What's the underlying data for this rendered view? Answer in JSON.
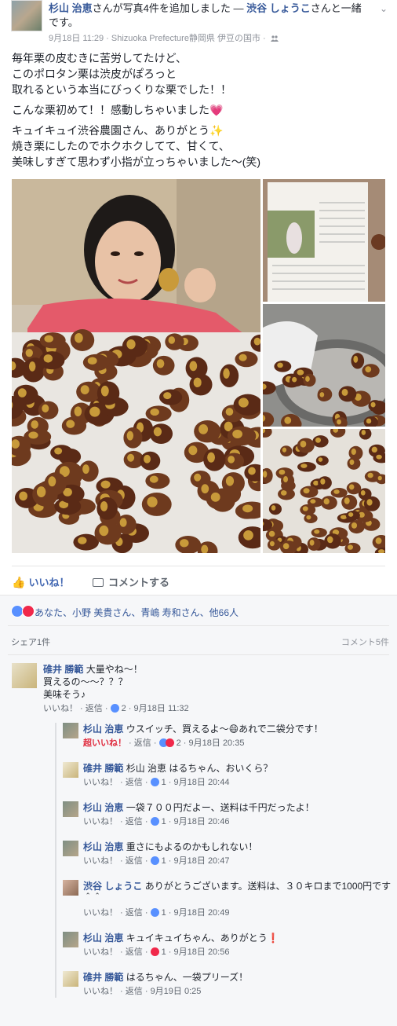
{
  "post": {
    "author": "杉山 治恵",
    "action_text": "さんが写真4件を追加しました — ",
    "tagged": "渋谷 しょうこ",
    "tagged_suffix": "さんと一緒です。",
    "timestamp": "9月18日 11:29 · Shizuoka Prefecture静岡県 伊豆の国市 ·",
    "paragraphs": [
      "毎年栗の皮むきに苦労してたけど、\nこのポロタン栗は渋皮がぽろっと\n取れるという本当にびっくりな栗でした！！",
      "こんな栗初めて！！感動しちゃいました💗",
      "キュイキュイ渋谷農園さん、ありがとう✨\n焼き栗にしたのでホクホクしてて、甘くて、\n美味しすぎて思わず小指が立っちゃいました〜(笑)"
    ]
  },
  "actions": {
    "like": "いいね！",
    "comment": "コメントする"
  },
  "reactions": {
    "text": "あなた、小野 美貴さん、青嶋 寿和さん、他66人"
  },
  "shares": {
    "share_count": "シェア1件",
    "comment_count": "コメント5件"
  },
  "comments": [
    {
      "author": "碓井 勝範",
      "lines": [
        "大量やね〜！",
        "買えるの〜〜？？？",
        "美味そう♪"
      ],
      "meta_like": "いいね！",
      "meta_reply": "返信",
      "meta_count": "2",
      "meta_time": "9月18日 11:32"
    }
  ],
  "replies": [
    {
      "author": "杉山 治恵",
      "text": "ウスイッチ、買えるよ〜😄あれで二袋分です！",
      "meta_like": "超いいね！",
      "meta_reply": "返信",
      "meta_count": "2",
      "meta_time": "9月18日 20:35",
      "super": true
    },
    {
      "author": "碓井 勝範",
      "text": "杉山 治恵 はるちゃん、おいくら？",
      "meta_like": "いいね！",
      "meta_reply": "返信",
      "meta_count": "1",
      "meta_time": "9月18日 20:44"
    },
    {
      "author": "杉山 治恵",
      "text": "一袋７００円だよー、送料は千円だったよ！",
      "meta_like": "いいね！",
      "meta_reply": "返信",
      "meta_count": "1",
      "meta_time": "9月18日 20:46"
    },
    {
      "author": "杉山 治恵",
      "text": "重さにもよるのかもしれない！",
      "meta_like": "いいね！",
      "meta_reply": "返信",
      "meta_count": "1",
      "meta_time": "9月18日 20:47"
    },
    {
      "author": "渋谷 しょうこ",
      "text": "ありがとうございます。送料は、３０キロまで1000円です\n＾＾",
      "meta_like": "いいね！",
      "meta_reply": "返信",
      "meta_count": "1",
      "meta_time": "9月18日 20:49"
    },
    {
      "author": "杉山 治恵",
      "text": "キュイキュイちゃん、ありがとう❗",
      "meta_like": "いいね！",
      "meta_reply": "返信",
      "meta_count": "1",
      "meta_time": "9月18日 20:56",
      "love": true
    },
    {
      "author": "碓井 勝範",
      "text": "はるちゃん、一袋プリーズ！",
      "meta_like": "いいね！",
      "meta_reply": "返信",
      "meta_count": "",
      "meta_time": "9月19日 0:25"
    }
  ]
}
